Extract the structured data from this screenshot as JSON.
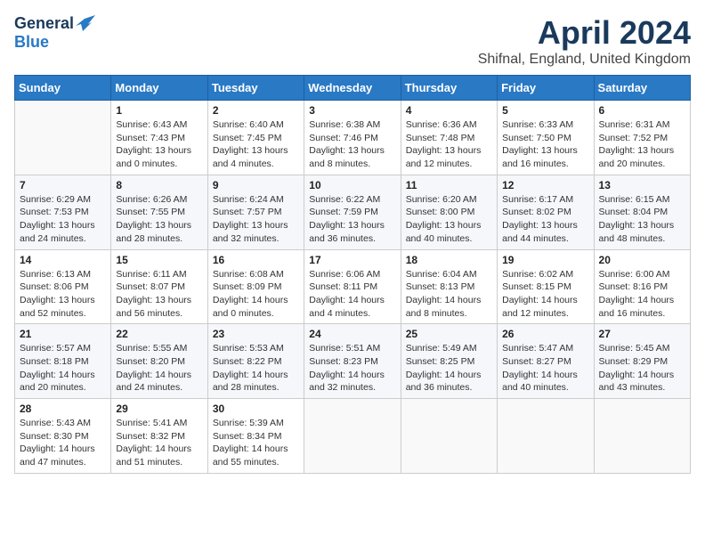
{
  "logo": {
    "general": "General",
    "blue": "Blue"
  },
  "header": {
    "month": "April 2024",
    "location": "Shifnal, England, United Kingdom"
  },
  "weekdays": [
    "Sunday",
    "Monday",
    "Tuesday",
    "Wednesday",
    "Thursday",
    "Friday",
    "Saturday"
  ],
  "weeks": [
    [
      {
        "day": "",
        "sunrise": "",
        "sunset": "",
        "daylight": ""
      },
      {
        "day": "1",
        "sunrise": "Sunrise: 6:43 AM",
        "sunset": "Sunset: 7:43 PM",
        "daylight": "Daylight: 13 hours and 0 minutes."
      },
      {
        "day": "2",
        "sunrise": "Sunrise: 6:40 AM",
        "sunset": "Sunset: 7:45 PM",
        "daylight": "Daylight: 13 hours and 4 minutes."
      },
      {
        "day": "3",
        "sunrise": "Sunrise: 6:38 AM",
        "sunset": "Sunset: 7:46 PM",
        "daylight": "Daylight: 13 hours and 8 minutes."
      },
      {
        "day": "4",
        "sunrise": "Sunrise: 6:36 AM",
        "sunset": "Sunset: 7:48 PM",
        "daylight": "Daylight: 13 hours and 12 minutes."
      },
      {
        "day": "5",
        "sunrise": "Sunrise: 6:33 AM",
        "sunset": "Sunset: 7:50 PM",
        "daylight": "Daylight: 13 hours and 16 minutes."
      },
      {
        "day": "6",
        "sunrise": "Sunrise: 6:31 AM",
        "sunset": "Sunset: 7:52 PM",
        "daylight": "Daylight: 13 hours and 20 minutes."
      }
    ],
    [
      {
        "day": "7",
        "sunrise": "Sunrise: 6:29 AM",
        "sunset": "Sunset: 7:53 PM",
        "daylight": "Daylight: 13 hours and 24 minutes."
      },
      {
        "day": "8",
        "sunrise": "Sunrise: 6:26 AM",
        "sunset": "Sunset: 7:55 PM",
        "daylight": "Daylight: 13 hours and 28 minutes."
      },
      {
        "day": "9",
        "sunrise": "Sunrise: 6:24 AM",
        "sunset": "Sunset: 7:57 PM",
        "daylight": "Daylight: 13 hours and 32 minutes."
      },
      {
        "day": "10",
        "sunrise": "Sunrise: 6:22 AM",
        "sunset": "Sunset: 7:59 PM",
        "daylight": "Daylight: 13 hours and 36 minutes."
      },
      {
        "day": "11",
        "sunrise": "Sunrise: 6:20 AM",
        "sunset": "Sunset: 8:00 PM",
        "daylight": "Daylight: 13 hours and 40 minutes."
      },
      {
        "day": "12",
        "sunrise": "Sunrise: 6:17 AM",
        "sunset": "Sunset: 8:02 PM",
        "daylight": "Daylight: 13 hours and 44 minutes."
      },
      {
        "day": "13",
        "sunrise": "Sunrise: 6:15 AM",
        "sunset": "Sunset: 8:04 PM",
        "daylight": "Daylight: 13 hours and 48 minutes."
      }
    ],
    [
      {
        "day": "14",
        "sunrise": "Sunrise: 6:13 AM",
        "sunset": "Sunset: 8:06 PM",
        "daylight": "Daylight: 13 hours and 52 minutes."
      },
      {
        "day": "15",
        "sunrise": "Sunrise: 6:11 AM",
        "sunset": "Sunset: 8:07 PM",
        "daylight": "Daylight: 13 hours and 56 minutes."
      },
      {
        "day": "16",
        "sunrise": "Sunrise: 6:08 AM",
        "sunset": "Sunset: 8:09 PM",
        "daylight": "Daylight: 14 hours and 0 minutes."
      },
      {
        "day": "17",
        "sunrise": "Sunrise: 6:06 AM",
        "sunset": "Sunset: 8:11 PM",
        "daylight": "Daylight: 14 hours and 4 minutes."
      },
      {
        "day": "18",
        "sunrise": "Sunrise: 6:04 AM",
        "sunset": "Sunset: 8:13 PM",
        "daylight": "Daylight: 14 hours and 8 minutes."
      },
      {
        "day": "19",
        "sunrise": "Sunrise: 6:02 AM",
        "sunset": "Sunset: 8:15 PM",
        "daylight": "Daylight: 14 hours and 12 minutes."
      },
      {
        "day": "20",
        "sunrise": "Sunrise: 6:00 AM",
        "sunset": "Sunset: 8:16 PM",
        "daylight": "Daylight: 14 hours and 16 minutes."
      }
    ],
    [
      {
        "day": "21",
        "sunrise": "Sunrise: 5:57 AM",
        "sunset": "Sunset: 8:18 PM",
        "daylight": "Daylight: 14 hours and 20 minutes."
      },
      {
        "day": "22",
        "sunrise": "Sunrise: 5:55 AM",
        "sunset": "Sunset: 8:20 PM",
        "daylight": "Daylight: 14 hours and 24 minutes."
      },
      {
        "day": "23",
        "sunrise": "Sunrise: 5:53 AM",
        "sunset": "Sunset: 8:22 PM",
        "daylight": "Daylight: 14 hours and 28 minutes."
      },
      {
        "day": "24",
        "sunrise": "Sunrise: 5:51 AM",
        "sunset": "Sunset: 8:23 PM",
        "daylight": "Daylight: 14 hours and 32 minutes."
      },
      {
        "day": "25",
        "sunrise": "Sunrise: 5:49 AM",
        "sunset": "Sunset: 8:25 PM",
        "daylight": "Daylight: 14 hours and 36 minutes."
      },
      {
        "day": "26",
        "sunrise": "Sunrise: 5:47 AM",
        "sunset": "Sunset: 8:27 PM",
        "daylight": "Daylight: 14 hours and 40 minutes."
      },
      {
        "day": "27",
        "sunrise": "Sunrise: 5:45 AM",
        "sunset": "Sunset: 8:29 PM",
        "daylight": "Daylight: 14 hours and 43 minutes."
      }
    ],
    [
      {
        "day": "28",
        "sunrise": "Sunrise: 5:43 AM",
        "sunset": "Sunset: 8:30 PM",
        "daylight": "Daylight: 14 hours and 47 minutes."
      },
      {
        "day": "29",
        "sunrise": "Sunrise: 5:41 AM",
        "sunset": "Sunset: 8:32 PM",
        "daylight": "Daylight: 14 hours and 51 minutes."
      },
      {
        "day": "30",
        "sunrise": "Sunrise: 5:39 AM",
        "sunset": "Sunset: 8:34 PM",
        "daylight": "Daylight: 14 hours and 55 minutes."
      },
      {
        "day": "",
        "sunrise": "",
        "sunset": "",
        "daylight": ""
      },
      {
        "day": "",
        "sunrise": "",
        "sunset": "",
        "daylight": ""
      },
      {
        "day": "",
        "sunrise": "",
        "sunset": "",
        "daylight": ""
      },
      {
        "day": "",
        "sunrise": "",
        "sunset": "",
        "daylight": ""
      }
    ]
  ]
}
